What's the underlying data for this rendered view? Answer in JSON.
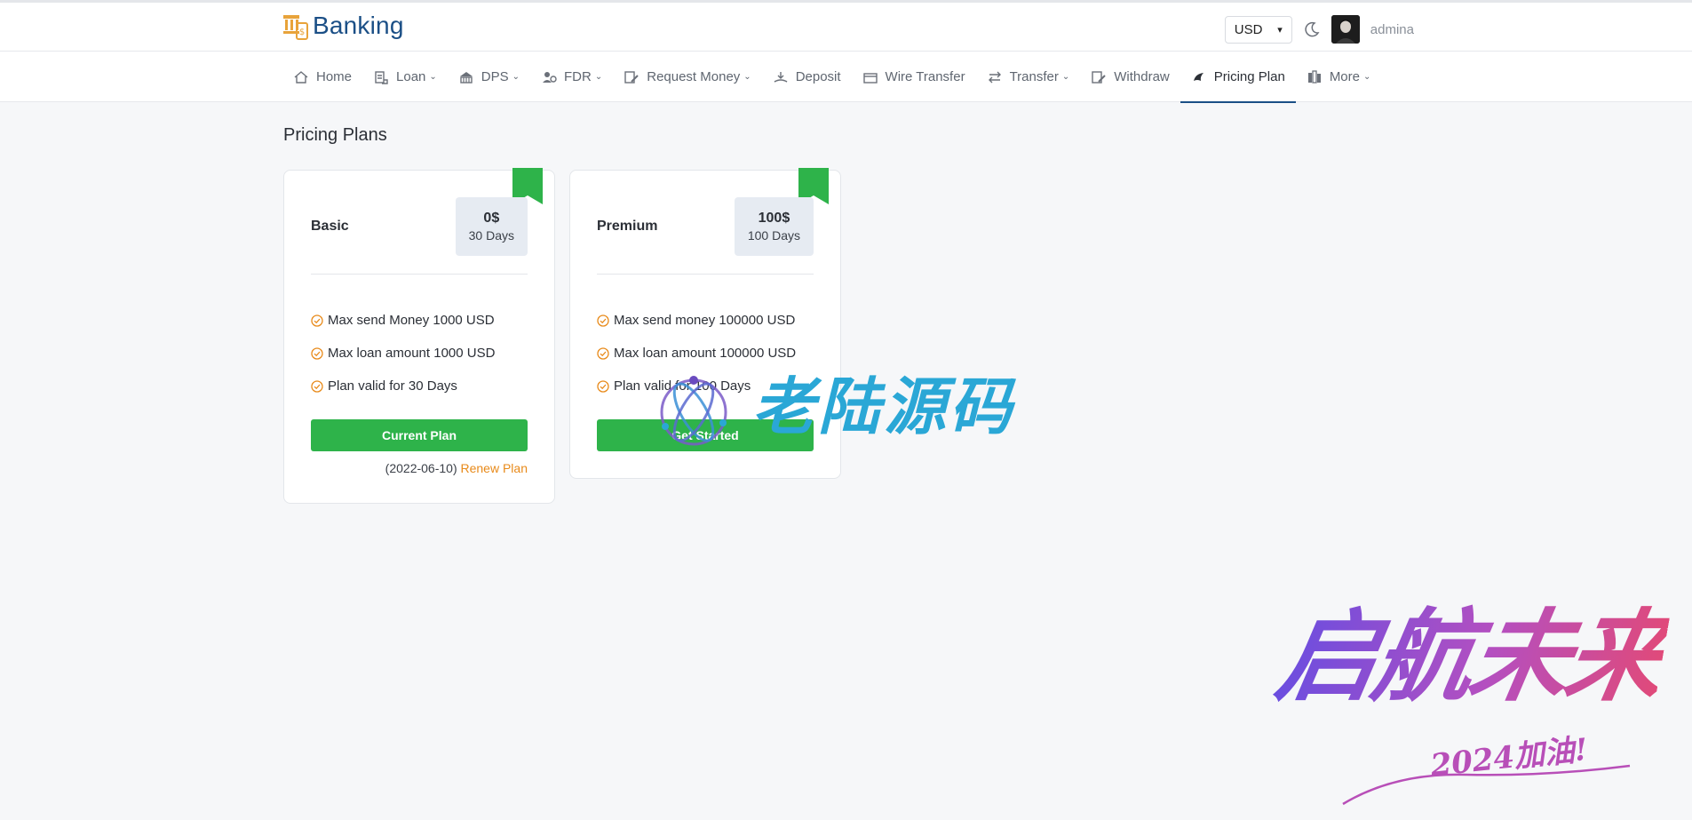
{
  "header": {
    "brand_name": "Banking",
    "currency": "USD",
    "username": "admina"
  },
  "nav": {
    "items": [
      {
        "label": "Home",
        "icon": "home-icon",
        "dropdown": false,
        "active": false
      },
      {
        "label": "Loan",
        "icon": "loan-icon",
        "dropdown": true,
        "active": false
      },
      {
        "label": "DPS",
        "icon": "dps-icon",
        "dropdown": true,
        "active": false
      },
      {
        "label": "FDR",
        "icon": "fdr-icon",
        "dropdown": true,
        "active": false
      },
      {
        "label": "Request Money",
        "icon": "request-money-icon",
        "dropdown": true,
        "active": false
      },
      {
        "label": "Deposit",
        "icon": "deposit-icon",
        "dropdown": false,
        "active": false
      },
      {
        "label": "Wire Transfer",
        "icon": "wire-transfer-icon",
        "dropdown": false,
        "active": false
      },
      {
        "label": "Transfer",
        "icon": "transfer-icon",
        "dropdown": true,
        "active": false
      },
      {
        "label": "Withdraw",
        "icon": "withdraw-icon",
        "dropdown": false,
        "active": false
      },
      {
        "label": "Pricing Plan",
        "icon": "pricing-plan-icon",
        "dropdown": false,
        "active": true
      },
      {
        "label": "More",
        "icon": "more-icon",
        "dropdown": true,
        "active": false
      }
    ]
  },
  "page": {
    "title": "Pricing Plans"
  },
  "plans": [
    {
      "name": "Basic",
      "price": "0$",
      "duration": "30 Days",
      "features": [
        "Max send Money 1000 USD",
        "Max loan amount 1000 USD",
        "Plan valid for 30 Days"
      ],
      "button_label": "Current Plan",
      "expiry": "(2022-06-10)",
      "renew_label": "Renew Plan"
    },
    {
      "name": "Premium",
      "price": "100$",
      "duration": "100 Days",
      "features": [
        "Max send money 100000 USD",
        "Max loan amount 100000 USD",
        "Plan valid for 100 Days"
      ],
      "button_label": "Get Started"
    }
  ],
  "watermarks": {
    "center_text": "老陆源码",
    "corner_text": "启航未来",
    "corner_sub": "2024加油!"
  },
  "colors": {
    "brand": "#1b4f86",
    "accent_green": "#2eb34a",
    "accent_orange": "#e88a1a",
    "price_box": "#e6ebf2"
  }
}
